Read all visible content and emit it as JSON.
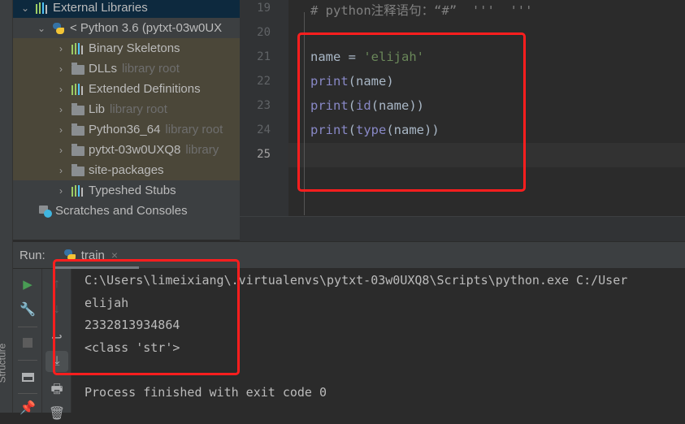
{
  "project_tree": {
    "items": [
      {
        "label": "External Libraries",
        "suffix": "",
        "icon": "library-icon",
        "expanded": true,
        "state": "selected"
      },
      {
        "label": "< Python 3.6 (pytxt-03w0UX",
        "suffix": "",
        "icon": "python-icon",
        "expanded": true,
        "state": "normal"
      },
      {
        "label": "Binary Skeletons",
        "suffix": "",
        "icon": "library-icon",
        "expanded": false,
        "state": "hl"
      },
      {
        "label": "DLLs",
        "suffix": "library root",
        "icon": "folder-icon",
        "expanded": false,
        "state": "hl"
      },
      {
        "label": "Extended Definitions",
        "suffix": "",
        "icon": "library-icon",
        "expanded": false,
        "state": "hl"
      },
      {
        "label": "Lib",
        "suffix": "library root",
        "icon": "folder-icon",
        "expanded": false,
        "state": "hl"
      },
      {
        "label": "Python36_64",
        "suffix": "library root",
        "icon": "folder-icon",
        "expanded": false,
        "state": "hl"
      },
      {
        "label": "pytxt-03w0UXQ8",
        "suffix": "library",
        "icon": "folder-icon",
        "expanded": false,
        "state": "hl"
      },
      {
        "label": "site-packages",
        "suffix": "",
        "icon": "folder-icon",
        "expanded": false,
        "state": "hl"
      },
      {
        "label": "Typeshed Stubs",
        "suffix": "",
        "icon": "library-icon",
        "expanded": false,
        "state": "normal"
      },
      {
        "label": "Scratches and Consoles",
        "suffix": "",
        "icon": "scratches-icon",
        "expanded": null,
        "state": "normal"
      }
    ]
  },
  "editor": {
    "line_numbers": [
      "19",
      "20",
      "21",
      "22",
      "23",
      "24",
      "25"
    ],
    "comment_line": "# python注释语句：“#”  '''  '''",
    "code": {
      "l21_var": "name",
      "l21_eq": " = ",
      "l21_str": "'elijah'",
      "l22_fn": "print",
      "l22_rest": "(name)",
      "l23_fn": "print",
      "l23_open": "(",
      "l23_fn2": "id",
      "l23_rest": "(name))",
      "l24_fn": "print",
      "l24_open": "(",
      "l24_fn2": "type",
      "l24_rest": "(name))"
    }
  },
  "run_panel": {
    "label": "Run:",
    "tab_name": "train",
    "close_icon": "×",
    "output": [
      "C:\\Users\\limeixiang\\.virtualenvs\\pytxt-03w0UXQ8\\Scripts\\python.exe C:/User",
      "elijah",
      "2332813934864",
      "<class 'str'>",
      "",
      "Process finished with exit code 0"
    ]
  },
  "side_tabs": {
    "structure": "Structure"
  },
  "colors": {
    "annotation_red": "#ff1e1e",
    "run_green": "#499c54"
  }
}
